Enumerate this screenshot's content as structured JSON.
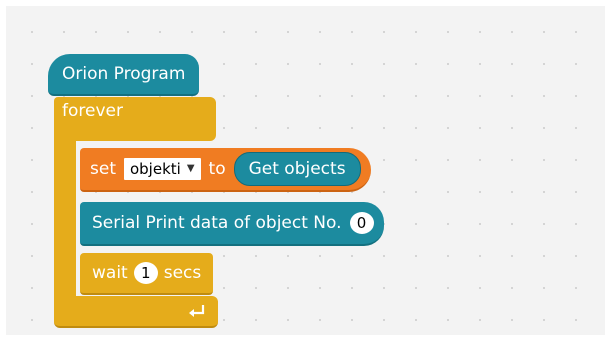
{
  "blocks": {
    "hat": {
      "label": "Orion Program"
    },
    "forever": {
      "label": "forever"
    },
    "set": {
      "label_set": "set",
      "variable": "objekti",
      "label_to": "to",
      "reporter": "Get objects"
    },
    "serial": {
      "label": "Serial Print data of object No.",
      "value": "0"
    },
    "wait": {
      "label_wait": "wait",
      "value": "1",
      "label_secs": "secs"
    }
  },
  "icons": {
    "dropdown": "triangle-down-icon",
    "loop": "loop-arrow-icon"
  },
  "colors": {
    "motion_blue": "#1c8b9f",
    "control_yellow": "#e5ac1b",
    "data_orange": "#f07c22",
    "canvas": "#f3f3f3"
  }
}
